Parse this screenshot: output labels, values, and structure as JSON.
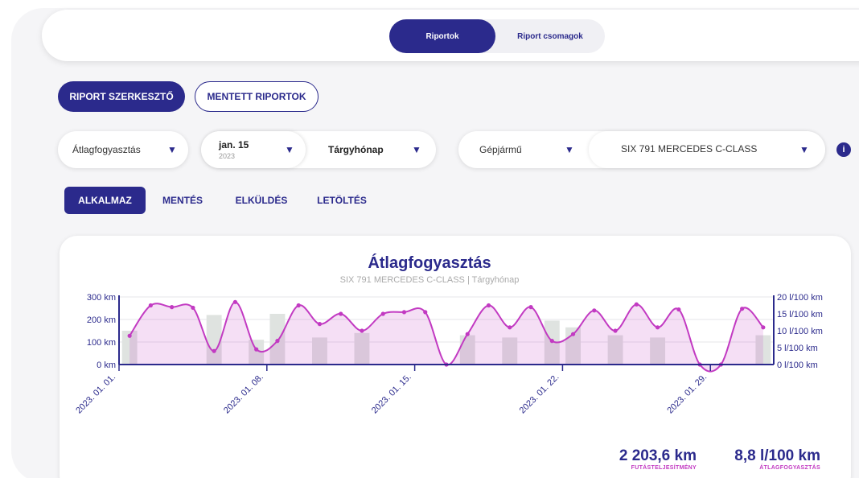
{
  "header": {
    "tabs": [
      {
        "label": "Riportok",
        "active": true
      },
      {
        "label": "Riport csomagok",
        "active": false
      }
    ]
  },
  "mode_buttons": {
    "editor": "RIPORT SZERKESZTŐ",
    "saved": "MENTETT RIPORTOK"
  },
  "filters": {
    "metric": "Átlagfogyasztás",
    "date_main": "jan. 15",
    "date_year": "2023",
    "period": "Tárgyhónap",
    "asset_type": "Gépjármű",
    "vehicle": "SIX 791 MERCEDES C-CLASS",
    "info": "i"
  },
  "actions": {
    "apply": "ALKALMAZ",
    "save": "MENTÉS",
    "send": "ELKÜLDÉS",
    "download": "LETÖLTÉS"
  },
  "colors": {
    "primary": "#2b2a8c",
    "accent": "#c23ac2",
    "bar": "#dfe3e0"
  },
  "chart_data": {
    "type": "bar",
    "title": "Átlagfogyasztás",
    "subtitle": "SIX 791 MERCEDES C-CLASS | Tárgyhónap",
    "y_left": {
      "ticks": [
        "300 km",
        "200 km",
        "100 km",
        "0 km"
      ],
      "max": 300
    },
    "y_right": {
      "ticks": [
        "20 l/100 km",
        "15 l/100 km",
        "10 l/100 km",
        "5 l/100 km",
        "0 l/100 km"
      ],
      "max": 20
    },
    "x_ticks": [
      "2023. 01. 01.",
      "2023. 01. 08.",
      "2023. 01. 15.",
      "2023. 01. 22.",
      "2023. 01. 29."
    ],
    "x_tick_days": [
      1,
      8,
      15,
      22,
      29
    ],
    "days": 31,
    "series": [
      {
        "name": "km",
        "axis": "left",
        "kind": "bar",
        "values": [
          150,
          0,
          0,
          0,
          220,
          0,
          110,
          225,
          0,
          120,
          0,
          140,
          0,
          0,
          0,
          0,
          130,
          0,
          120,
          0,
          195,
          165,
          0,
          130,
          0,
          120,
          0,
          0,
          0,
          0,
          130
        ]
      },
      {
        "name": "l/100 km",
        "axis": "right",
        "kind": "line",
        "values": [
          8.5,
          17.5,
          17,
          16.8,
          4,
          18.5,
          4.5,
          7,
          17.5,
          12,
          15,
          10,
          15,
          15.5,
          15.5,
          0,
          9,
          17.5,
          11,
          17,
          7,
          9,
          16,
          10,
          17.8,
          11,
          16.3,
          0,
          0,
          16.5,
          11
        ]
      }
    ]
  },
  "stats": [
    {
      "value": "2 203,6 km",
      "label": "FUTÁSTELJESÍTMÉNY"
    },
    {
      "value": "8,8 l/100 km",
      "label": "ÁTLAGFOGYASZTÁS"
    }
  ]
}
